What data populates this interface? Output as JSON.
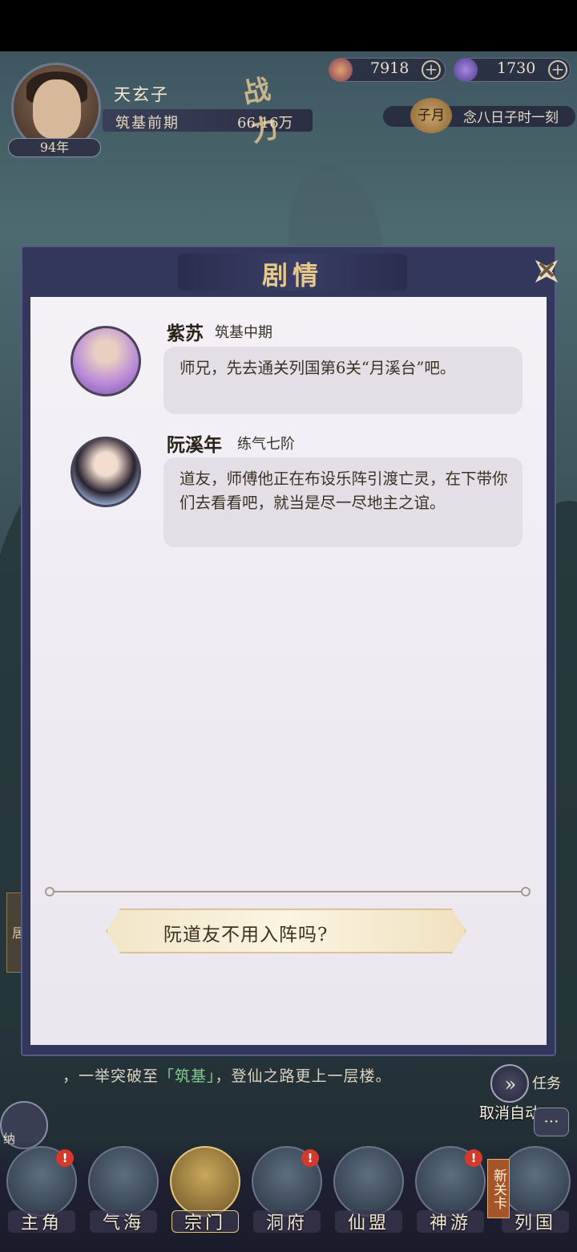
{
  "player": {
    "name": "天玄子",
    "realm": "筑基前期",
    "power": "66.16万",
    "power_emblem": "战力",
    "age": "94年"
  },
  "resources": [
    {
      "value": "7918",
      "icon": "spirit-stone-icon",
      "plus": "+"
    },
    {
      "value": "1730",
      "icon": "crystal-icon",
      "plus": "+"
    }
  ],
  "calendar": {
    "month": "子月",
    "date": "念八日子时一刻"
  },
  "dialog": {
    "title": "剧情",
    "close_icon": "✕",
    "messages": [
      {
        "name": "紫苏",
        "realm": "筑基中期",
        "text": "师兄，先去通关列国第6关“月溪台”吧。"
      },
      {
        "name": "阮溪年",
        "realm": "练气七阶",
        "text": "道友，师傅他正在布设乐阵引渡亡灵，在下带你们去看看吧，就当是尽一尽地主之谊。"
      }
    ],
    "choice": "阮道友不用入阵吗?"
  },
  "story": {
    "prefix": "，一举突破至",
    "highlight": "「筑基」",
    "suffix": "，登仙之路更上一层楼。"
  },
  "auto": {
    "label": "取消自动",
    "icon": "»"
  },
  "side": {
    "task": "任务",
    "chat_icon": "···",
    "bag": "纳",
    "tab": "居"
  },
  "nav": {
    "items": [
      {
        "label": "主角",
        "badge": "!"
      },
      {
        "label": "气海",
        "badge": ""
      },
      {
        "label": "宗门",
        "badge": ""
      },
      {
        "label": "洞府",
        "badge": "!"
      },
      {
        "label": "仙盟",
        "badge": ""
      },
      {
        "label": "神游",
        "badge": "!"
      },
      {
        "label": "列国",
        "badge": ""
      }
    ],
    "new_tag": "新关卡"
  },
  "colors": {
    "accent_gold": "#e7c98a",
    "panel_bg": "#f4f1f7",
    "frame": "#34375c",
    "highlight_green": "#7fcf8a"
  }
}
